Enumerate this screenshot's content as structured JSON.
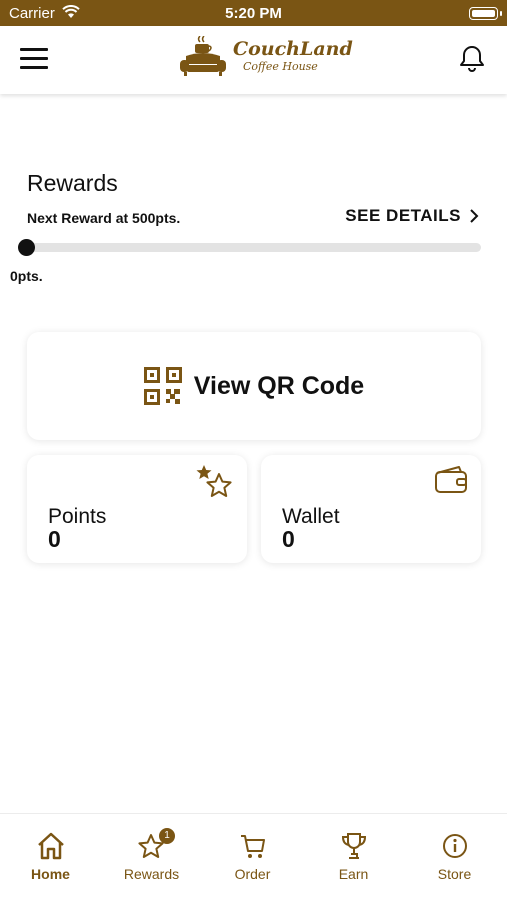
{
  "status_bar": {
    "carrier": "Carrier",
    "time": "5:20 PM"
  },
  "header": {
    "logo_name": "CouchLand",
    "logo_sub": "Coffee House",
    "icons": {
      "menu": "hamburger-menu-icon",
      "notifications": "bell-icon"
    }
  },
  "rewards": {
    "title": "Rewards",
    "next_reward_text": "Next Reward at 500pts.",
    "see_details_label": "SEE DETAILS",
    "current_points_label": "0pts.",
    "progress_fraction": 0
  },
  "qr": {
    "label": "View QR Code",
    "icon": "qr-code-icon"
  },
  "points_card": {
    "label": "Points",
    "value": "0",
    "icon": "stars-icon"
  },
  "wallet_card": {
    "label": "Wallet",
    "value": "0",
    "icon": "wallet-icon"
  },
  "tabs": [
    {
      "label": "Home",
      "icon": "home-icon",
      "active": true
    },
    {
      "label": "Rewards",
      "icon": "star-icon",
      "badge": "1"
    },
    {
      "label": "Order",
      "icon": "cart-icon"
    },
    {
      "label": "Earn",
      "icon": "trophy-icon"
    },
    {
      "label": "Store",
      "icon": "info-icon"
    }
  ],
  "colors": {
    "accent": "#7a5514",
    "text": "#111111",
    "track": "#e3e3e3"
  }
}
